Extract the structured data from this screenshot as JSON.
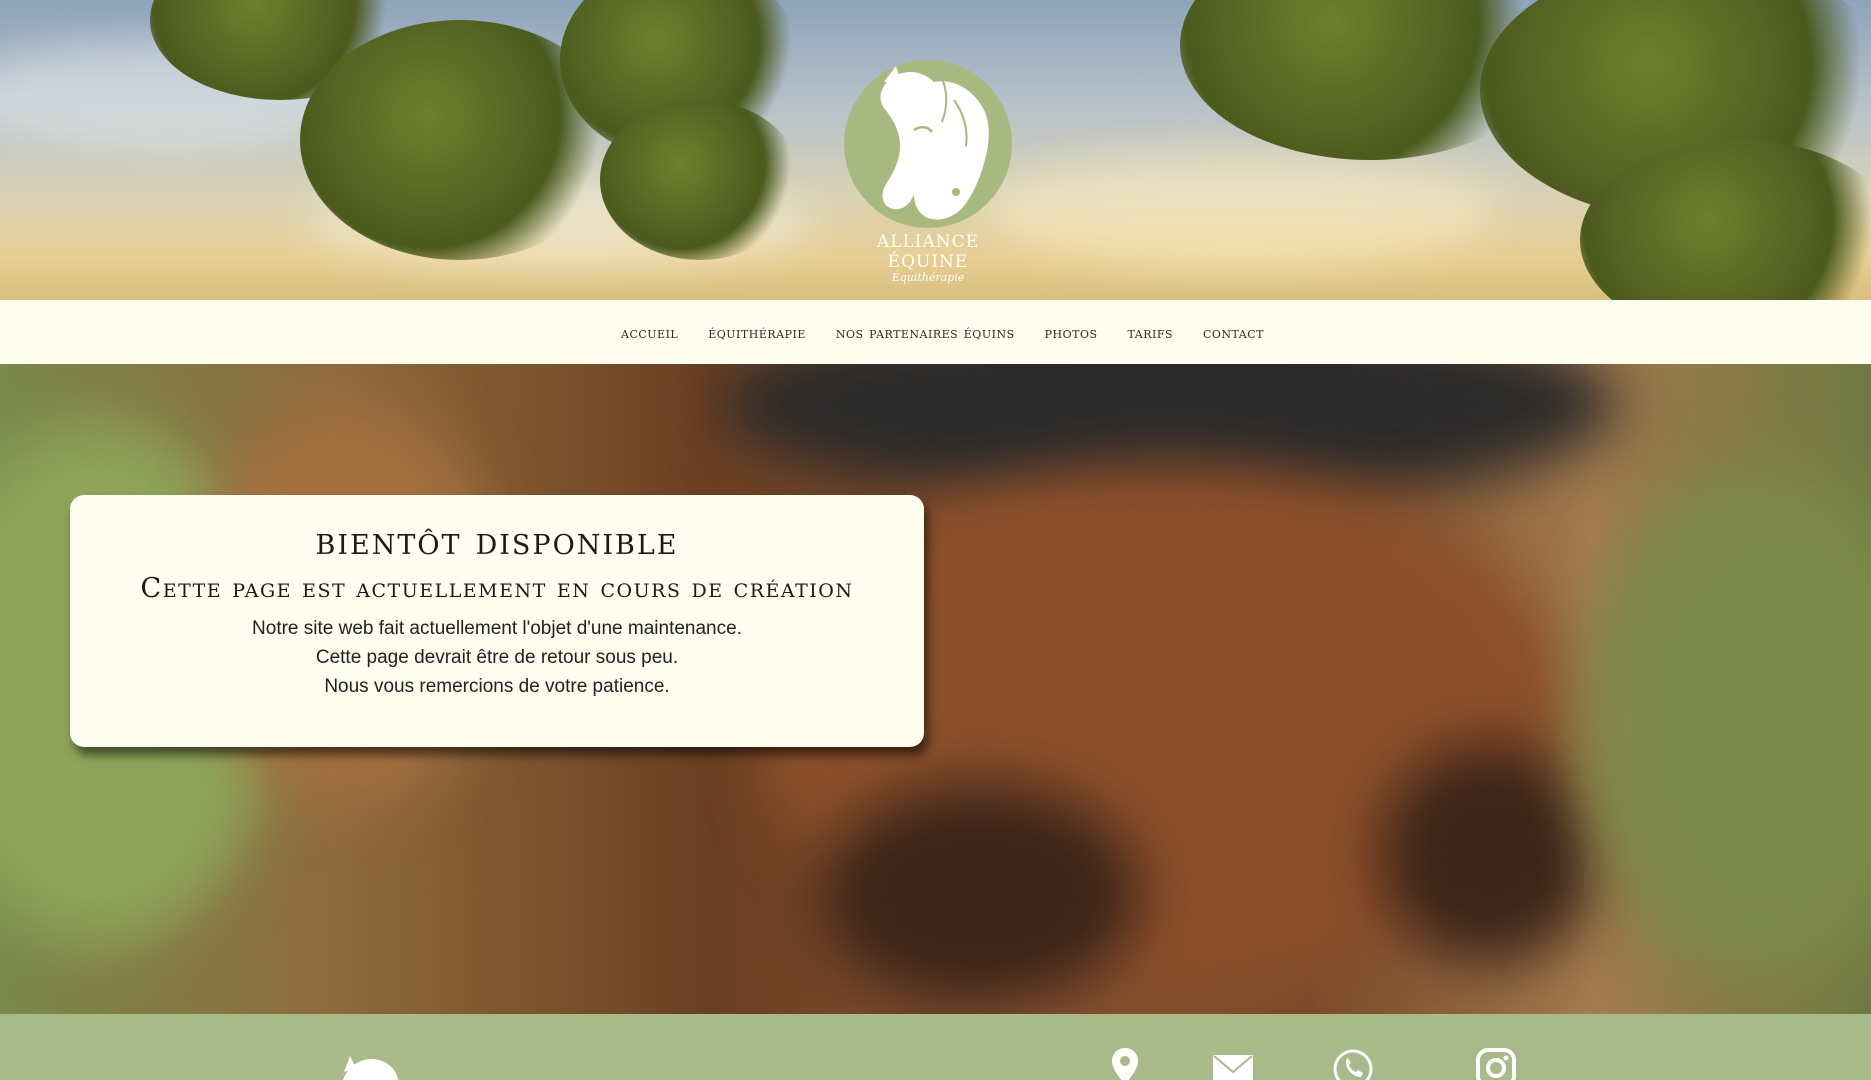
{
  "brand": {
    "name": "ALLIANCE ÉQUINE",
    "tagline": "Équithérapie"
  },
  "nav": {
    "items": [
      {
        "label": "Accueil"
      },
      {
        "label": "Équithérapie"
      },
      {
        "label": "Nos partenaires équins"
      },
      {
        "label": "Photos"
      },
      {
        "label": "Tarifs"
      },
      {
        "label": "Contact"
      }
    ]
  },
  "notice": {
    "title": "Bientôt disponible",
    "subtitle": "Cette page est actuellement en cours de création",
    "lines": [
      "Notre site web fait actuellement l'objet d'une maintenance.",
      "Cette page devrait être de retour sous peu.",
      "Nous vous remercions de votre patience."
    ]
  },
  "footer": {
    "icons": [
      "horse-logo-icon",
      "location-pin-icon",
      "mail-icon",
      "phone-icon",
      "instagram-icon"
    ]
  },
  "colors": {
    "accent_green": "#a8b97f",
    "footer_green": "#a8b98a",
    "cream": "#fefdf0"
  }
}
